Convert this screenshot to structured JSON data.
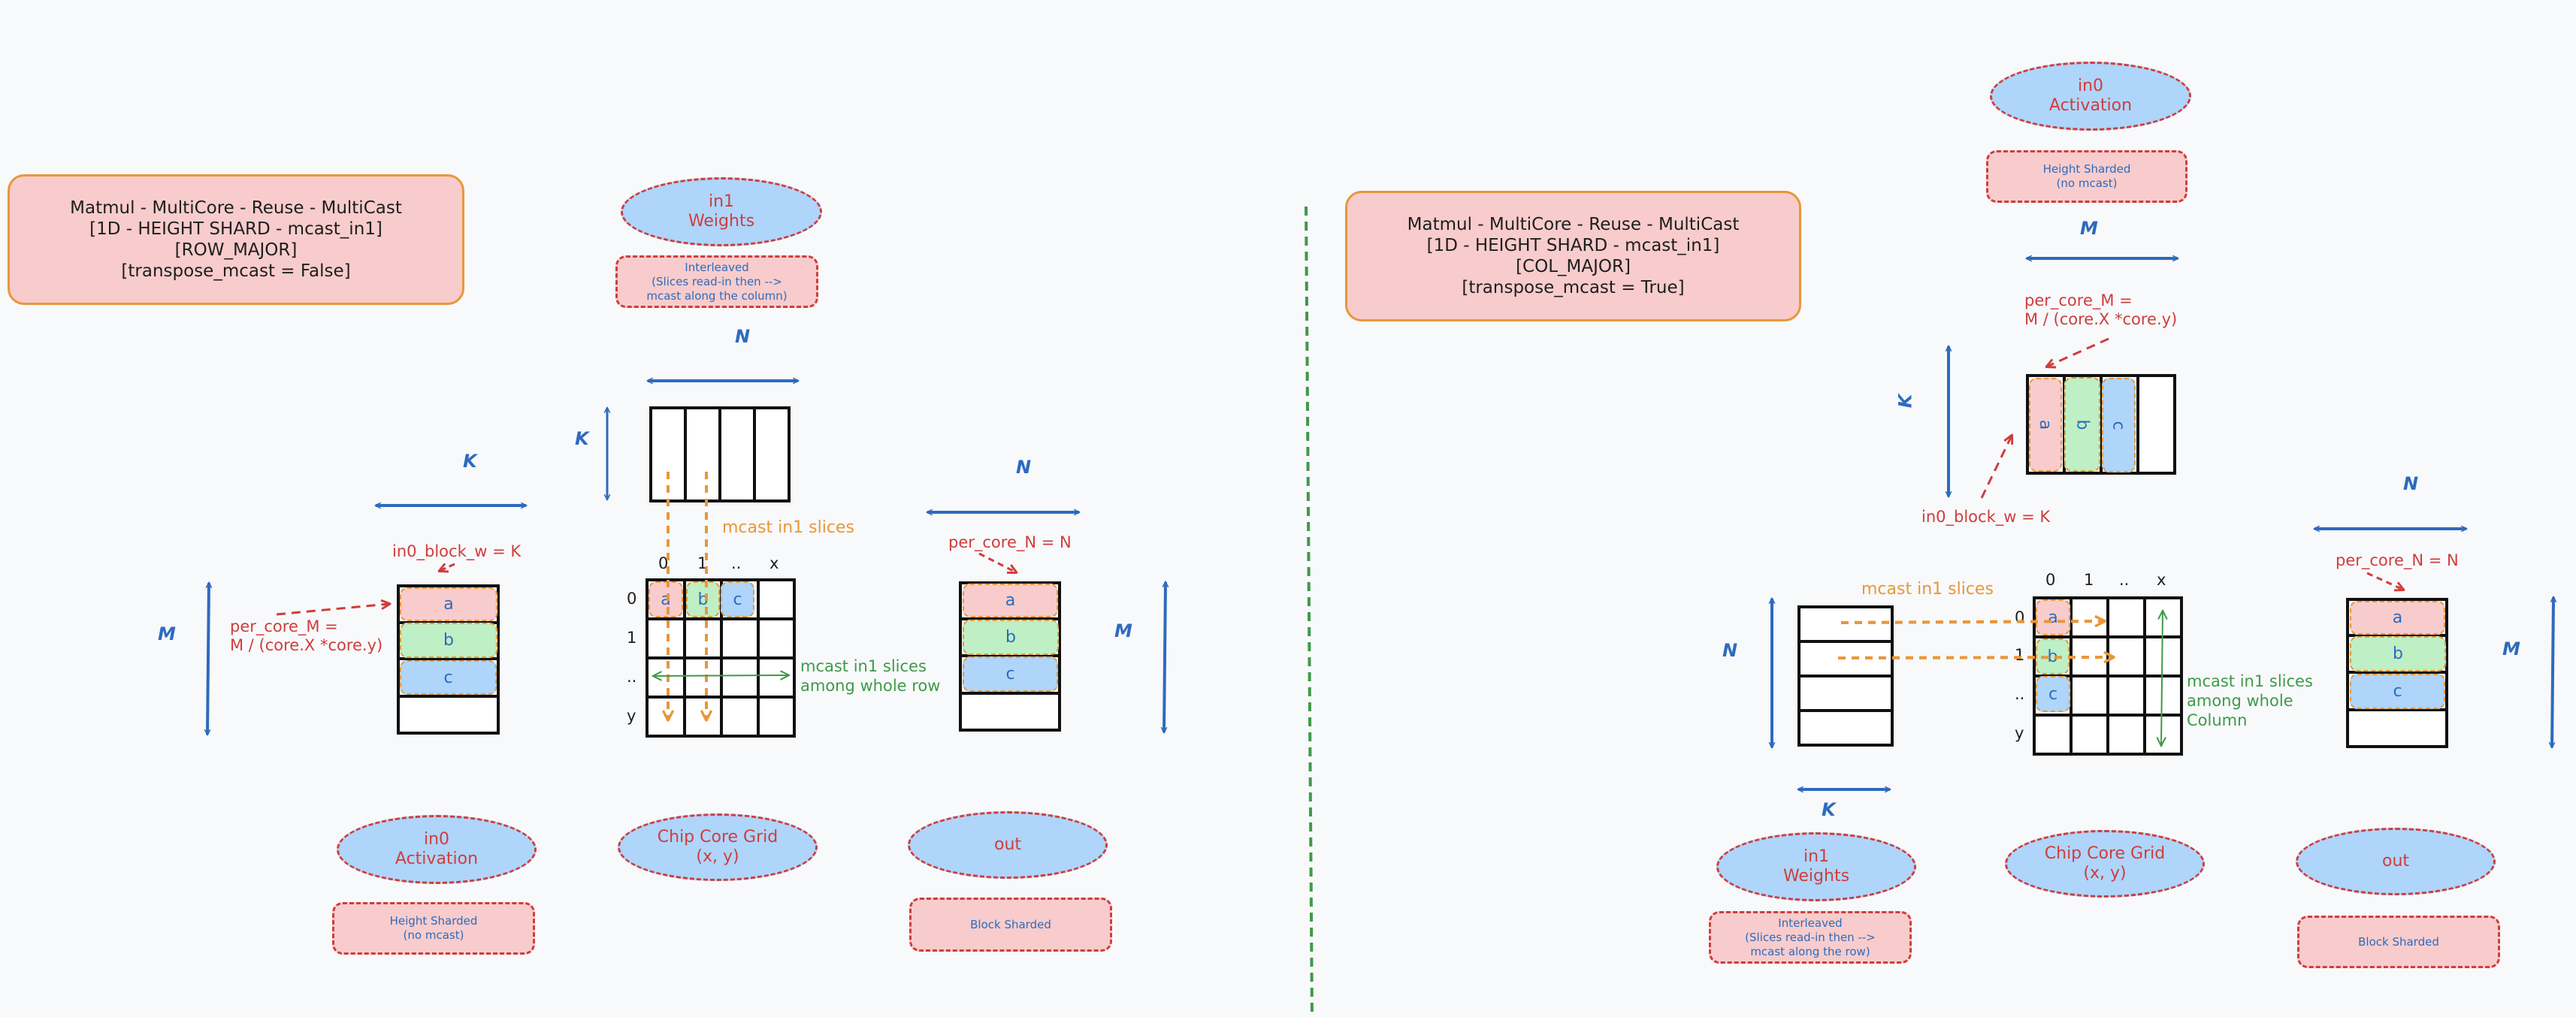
{
  "colors": {
    "background": "#f8f9fb",
    "title_fill": "#f8cccc",
    "title_border": "#e8973a",
    "ellipse_fill": "#afd5fa",
    "dashed_red": "#cf3d3d",
    "dimension_blue": "#2d6bbd",
    "mcast_orange": "#e8973a",
    "mcast_green": "#3f9a48",
    "slice_a": "#f8cccc",
    "slice_b": "#bfefc4",
    "slice_c": "#afd5fa"
  },
  "left": {
    "title": [
      "Matmul - MultiCore - Reuse - MultiCast",
      "[1D - HEIGHT SHARD - mcast_in1]",
      "[ROW_MAJOR]",
      "[transpose_mcast = False]"
    ],
    "in1": {
      "name": "in1",
      "role": "Weights",
      "note": [
        "Interleaved",
        "(Slices read-in then  -->",
        "mcast along the column)"
      ]
    },
    "in1_dims": {
      "width": "N",
      "height": "K"
    },
    "in0": {
      "name": "in0",
      "role": "Activation",
      "note": [
        "Height Sharded",
        "(no mcast)"
      ]
    },
    "in0_dims": {
      "width": "K",
      "height": "M"
    },
    "in0_block_w": "in0_block_w = K",
    "per_core_m": [
      "per_core_M =",
      "M / (core.X *core.y)"
    ],
    "grid": {
      "label": [
        "Chip Core Grid",
        "(x, y)"
      ],
      "col_headers": [
        "0",
        "1",
        "..",
        "x"
      ],
      "row_headers": [
        "0",
        "1",
        "..",
        "y"
      ]
    },
    "slices": [
      "a",
      "b",
      "c"
    ],
    "mcast_slices": "mcast in1 slices",
    "mcast_among": [
      "mcast in1 slices",
      "among whole row"
    ],
    "out": {
      "name": "out",
      "note": [
        "Block Sharded"
      ]
    },
    "out_dims": {
      "width": "N",
      "height": "M"
    },
    "per_core_n": "per_core_N = N"
  },
  "right": {
    "title": [
      "Matmul - MultiCore - Reuse - MultiCast",
      "[1D - HEIGHT SHARD - mcast_in1]",
      "[COL_MAJOR]",
      "[transpose_mcast = True]"
    ],
    "in0": {
      "name": "in0",
      "role": "Activation",
      "note": [
        "Height Sharded",
        "(no mcast)"
      ]
    },
    "in0_dims": {
      "width": "M",
      "height": "K"
    },
    "per_core_m": [
      "per_core_M =",
      "M / (core.X *core.y)"
    ],
    "in0_block_w": "in0_block_w = K",
    "in1": {
      "name": "in1",
      "role": "Weights",
      "note": [
        "Interleaved",
        "(Slices read-in then  -->",
        "mcast along the row)"
      ]
    },
    "in1_dims": {
      "width": "K",
      "height": "N"
    },
    "grid": {
      "label": [
        "Chip Core Grid",
        "(x, y)"
      ],
      "col_headers": [
        "0",
        "1",
        "..",
        "x"
      ],
      "row_headers": [
        "0",
        "1",
        "..",
        "y"
      ]
    },
    "slices": [
      "a",
      "b",
      "c"
    ],
    "mcast_slices": "mcast in1 slices",
    "mcast_among": [
      "mcast in1 slices",
      "among whole",
      "Column"
    ],
    "out": {
      "name": "out",
      "note": [
        "Block Sharded"
      ]
    },
    "out_dims": {
      "width": "N",
      "height": "M"
    },
    "per_core_n": "per_core_N = N"
  }
}
